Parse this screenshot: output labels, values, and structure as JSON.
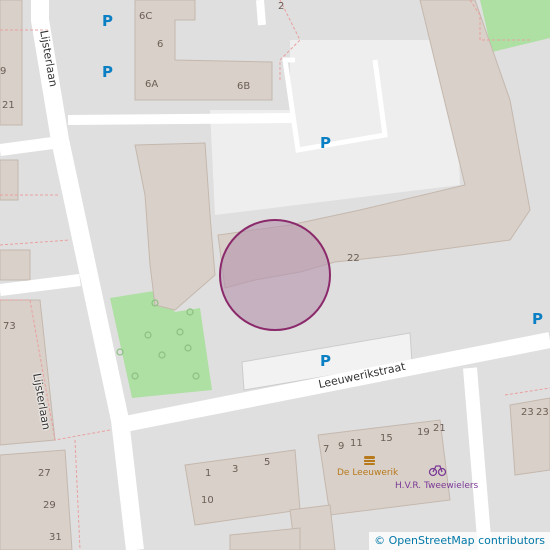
{
  "map": {
    "streets": [
      "Lijsterlaan",
      "Lijsterlaan",
      "Leeuwerikstraat"
    ],
    "parking_label": "P",
    "house_numbers": [
      "6C",
      "6",
      "6A",
      "6B",
      "9",
      "21",
      "22",
      "73",
      "23",
      "27",
      "29",
      "31",
      "1",
      "3",
      "5",
      "10",
      "7",
      "9",
      "11",
      "15",
      "19",
      "21",
      "23",
      "2"
    ],
    "pois": [
      {
        "name": "De Leeuwerik",
        "icon": "fast-food-icon",
        "color": "#b8791b"
      },
      {
        "name": "H.V.R. Tweewielers",
        "icon": "bicycle-icon",
        "color": "#7b3a96"
      }
    ],
    "marker": {
      "icon": "location-circle",
      "color": "#8b2a6b"
    },
    "attribution": "© OpenStreetMap contributors",
    "colors": {
      "building": "#d9d0c9",
      "park": "#aedfa3",
      "parking_area": "#eeeeee",
      "road": "#ffffff",
      "parking_text": "#0a7fc4"
    }
  }
}
